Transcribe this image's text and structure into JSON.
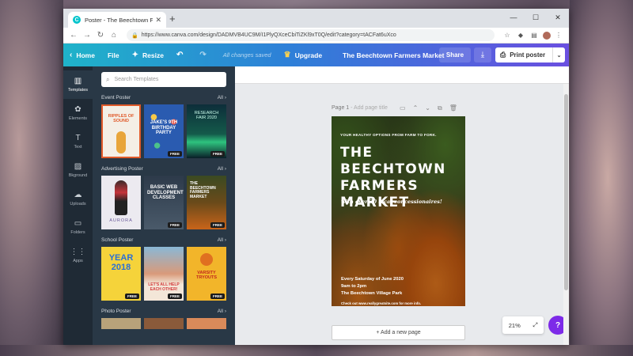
{
  "browser": {
    "tab_title": "Poster - The Beechtown Farmers",
    "url": "https://www.canva.com/design/DADMVB4UC9M/I1PlyQXceCbiTiZKl9xT0Q/edit?category=tACFat6uXco"
  },
  "header": {
    "home": "Home",
    "file": "File",
    "resize": "Resize",
    "changes_saved": "All changes saved",
    "upgrade": "Upgrade",
    "design_title": "The Beechtown Farmers Market",
    "share": "Share",
    "print": "Print poster"
  },
  "rail": {
    "items": [
      {
        "label": "Templates"
      },
      {
        "label": "Elements"
      },
      {
        "label": "Text"
      },
      {
        "label": "Bkground"
      },
      {
        "label": "Uploads"
      },
      {
        "label": "Folders"
      },
      {
        "label": "Apps"
      }
    ]
  },
  "panel": {
    "search_placeholder": "Search Templates",
    "all_label": "All",
    "sections": [
      {
        "title": "Event Poster"
      },
      {
        "title": "Advertising Poster"
      },
      {
        "title": "School Poster"
      },
      {
        "title": "Photo Poster"
      }
    ],
    "free_badge": "FREE",
    "thumbs": {
      "t1": "RIPPLES OF SOUND",
      "t2": "JAKE'S 9TH BIRTHDAY PARTY",
      "t3": "RESEARCH FAIR 2020",
      "t4": "AURORA",
      "t5": "BASIC WEB DEVELOPMENT CLASSES",
      "t6": "THE BEECHTOWN FARMERS MARKET",
      "t7": "YEAR 2018",
      "t8": "LET'S ALL HELP EACH OTHER!",
      "t9": "VARSITY TRYOUTS"
    }
  },
  "canvas": {
    "page_label": "Page 1",
    "page_title_placeholder": "- Add page title",
    "add_page": "+ Add a new page",
    "zoom": "21%",
    "help": "?"
  },
  "poster": {
    "tagline": "YOUR HEALTHY OPTIONS FROM FARM TO FORK.",
    "title_line1": "THE BEECHTOWN",
    "title_line2": "FARMERS",
    "title_line3": "MARKET",
    "script": "with over 30 local concessionaires!",
    "date_line1": "Every Saturday of June 2020",
    "date_line2": "9am to 2pm",
    "date_line3": "The Beechtown Village Park",
    "check": "Check out www.reallygreatsite.com for more info."
  }
}
